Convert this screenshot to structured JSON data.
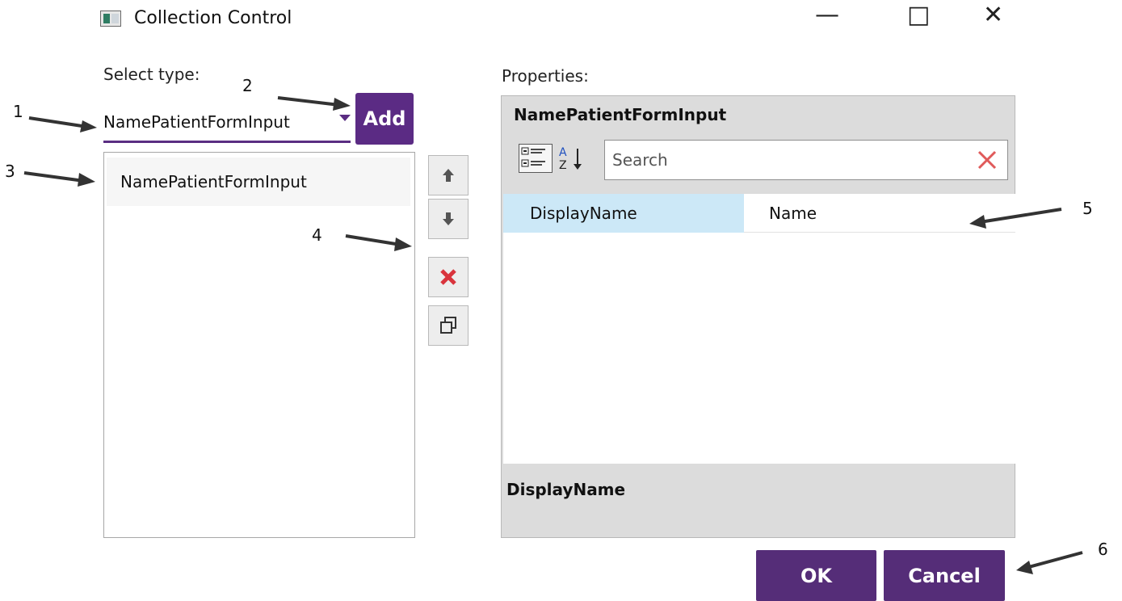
{
  "window": {
    "title": "Collection Control",
    "icon": "window-app-icon",
    "controls": {
      "minimize": "—",
      "maximize": "□",
      "close": "✕"
    }
  },
  "left": {
    "select_type_label": "Select type:",
    "selected_type": "NamePatientFormInput",
    "add_label": "Add",
    "items": [
      "NamePatientFormInput"
    ]
  },
  "right": {
    "properties_label": "Properties:",
    "object_title": "NamePatientFormInput",
    "search_placeholder": "Search",
    "property_rows": [
      {
        "name": "DisplayName",
        "value": "Name"
      }
    ],
    "description_title": "DisplayName"
  },
  "buttons": {
    "ok": "OK",
    "cancel": "Cancel"
  },
  "annotations": [
    "1",
    "2",
    "3",
    "4",
    "5",
    "6"
  ],
  "colors": {
    "accent_purple": "#5b2b84",
    "selection_blue": "#cce8f7",
    "delete_red": "#d9343d",
    "panel_gray": "#dcdcdc"
  },
  "icons": {
    "move_up": "arrow-up-icon",
    "move_down": "arrow-down-icon",
    "delete": "red-x-icon",
    "duplicate": "copy-icon",
    "categorized": "categorized-icon",
    "alphabetical": "az-sort-icon",
    "clear_search": "clear-icon"
  }
}
